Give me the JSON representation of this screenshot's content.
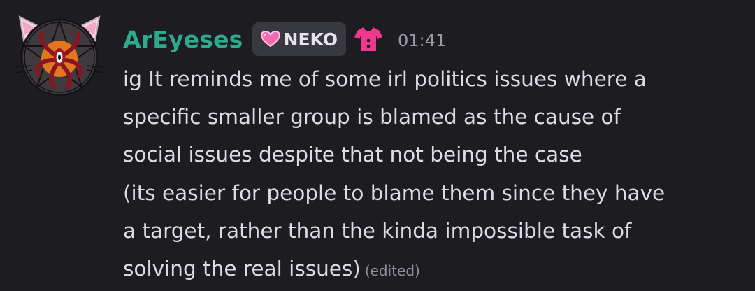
{
  "message": {
    "username": "ArEyeses",
    "username_color": "#2ea98a",
    "tag": {
      "icon": "pink-heart-icon",
      "label": "NEKO"
    },
    "badge_icon": "pink-shirt-icon",
    "timestamp": "01:41",
    "lines": [
      "ig It reminds me of some irl politics issues where a",
      "specific smaller group is blamed as the cause of",
      "social issues despite that not being the case",
      "(its easier for people to blame them since they have",
      "a target, rather than the kinda impossible task of",
      "solving the real issues)"
    ],
    "edited_label": "(edited)"
  },
  "colors": {
    "background": "#1c1c21",
    "text": "#dcdce4",
    "muted": "#9a9aa5",
    "tag_bg": "#38383f",
    "pink": "#f0388f"
  }
}
